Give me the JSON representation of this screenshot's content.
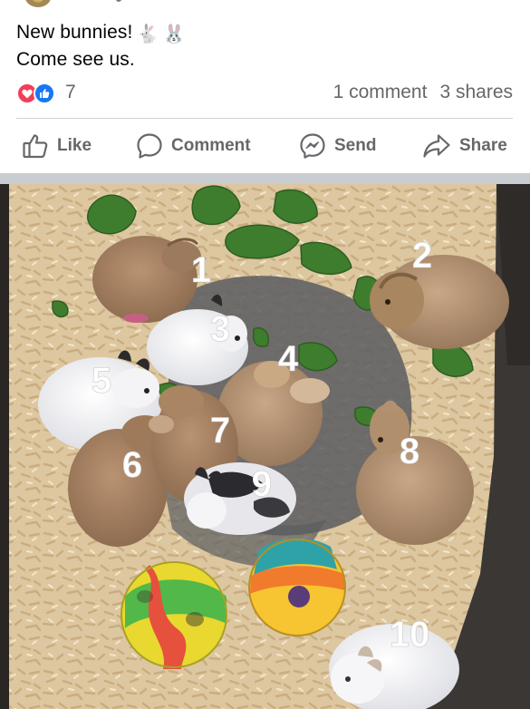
{
  "post": {
    "caption_line1": "New bunnies!",
    "caption_line2": "Come see us.",
    "caption_emojis": [
      "🐇",
      "🐰"
    ],
    "reaction_types": [
      "love-icon",
      "like-icon"
    ],
    "reaction_count": "7",
    "comments": "1 comment",
    "shares": "3 shares"
  },
  "actions": {
    "like": "Like",
    "comment": "Comment",
    "send": "Send",
    "share": "Share"
  },
  "photo": {
    "bunny_labels": [
      "1",
      "2",
      "3",
      "4",
      "5",
      "6",
      "7",
      "8",
      "9",
      "10"
    ]
  },
  "colors": {
    "love": "#f33e58",
    "like": "#1877f2",
    "muted_text": "#65676b",
    "separator": "#c9ccd1"
  }
}
